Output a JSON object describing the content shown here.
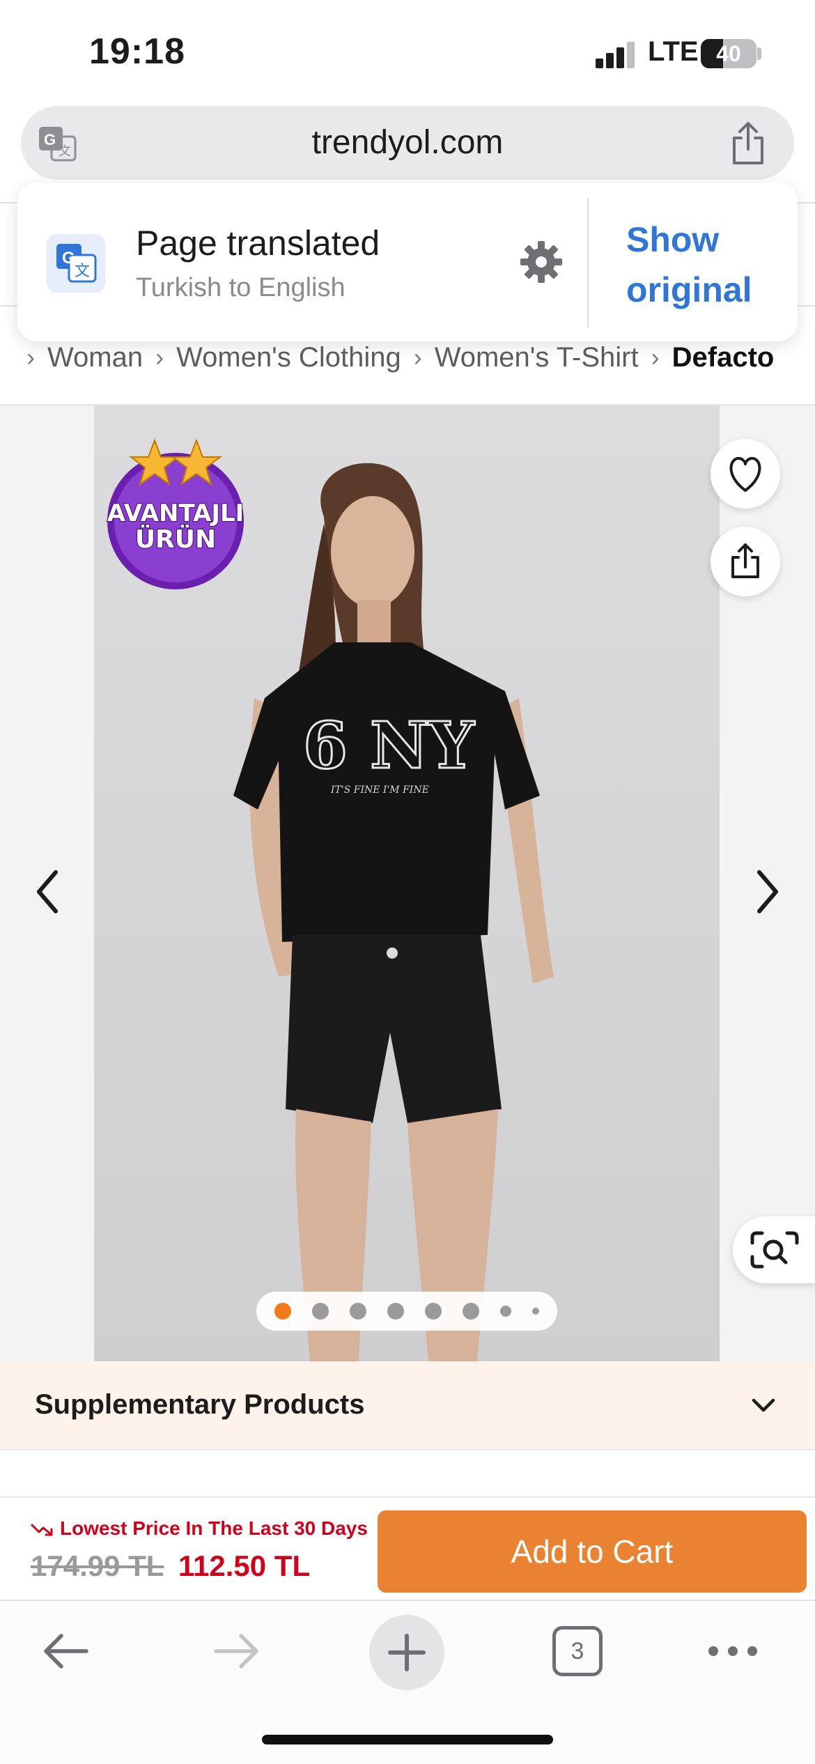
{
  "status_bar": {
    "time": "19:18",
    "network": "LTE",
    "battery": "40",
    "battery_level": 0.4
  },
  "browser": {
    "url": "trendyol.com",
    "open_tabs": "3"
  },
  "translation": {
    "title": "Page translated",
    "subtitle": "Turkish to English",
    "show_original": "Show original"
  },
  "breadcrumb": [
    "Woman",
    "Women's Clothing",
    "Women's T-Shirt",
    "Defacto"
  ],
  "product": {
    "badge_line1": "AVANTAJLI",
    "badge_line2": "ÜRÜN",
    "shirt_print": "6 NY",
    "shirt_subprint": "IT'S FINE I'M FINE",
    "image_count": 8,
    "active_image_index": 0
  },
  "supplementary": {
    "label": "Supplementary Products"
  },
  "purchase": {
    "lowest_price_note": "Lowest Price In The Last 30 Days",
    "old_price": "174.99 TL",
    "new_price": "112.50 TL",
    "add_to_cart": "Add to Cart"
  },
  "colors": {
    "brand_orange": "#f27a1a",
    "cart_button": "#ea8331",
    "price_red": "#d0021b",
    "link_blue": "#2f76d8",
    "badge_purple": "#7b2fbe"
  },
  "icons": [
    "translate-icon",
    "share-icon",
    "gear-icon",
    "heart-icon",
    "chevron-left-icon",
    "chevron-right-icon",
    "visual-search-icon",
    "chevron-down-icon",
    "trend-down-icon",
    "back-arrow-icon",
    "forward-arrow-icon",
    "plus-icon",
    "tabs-icon",
    "more-icon"
  ]
}
